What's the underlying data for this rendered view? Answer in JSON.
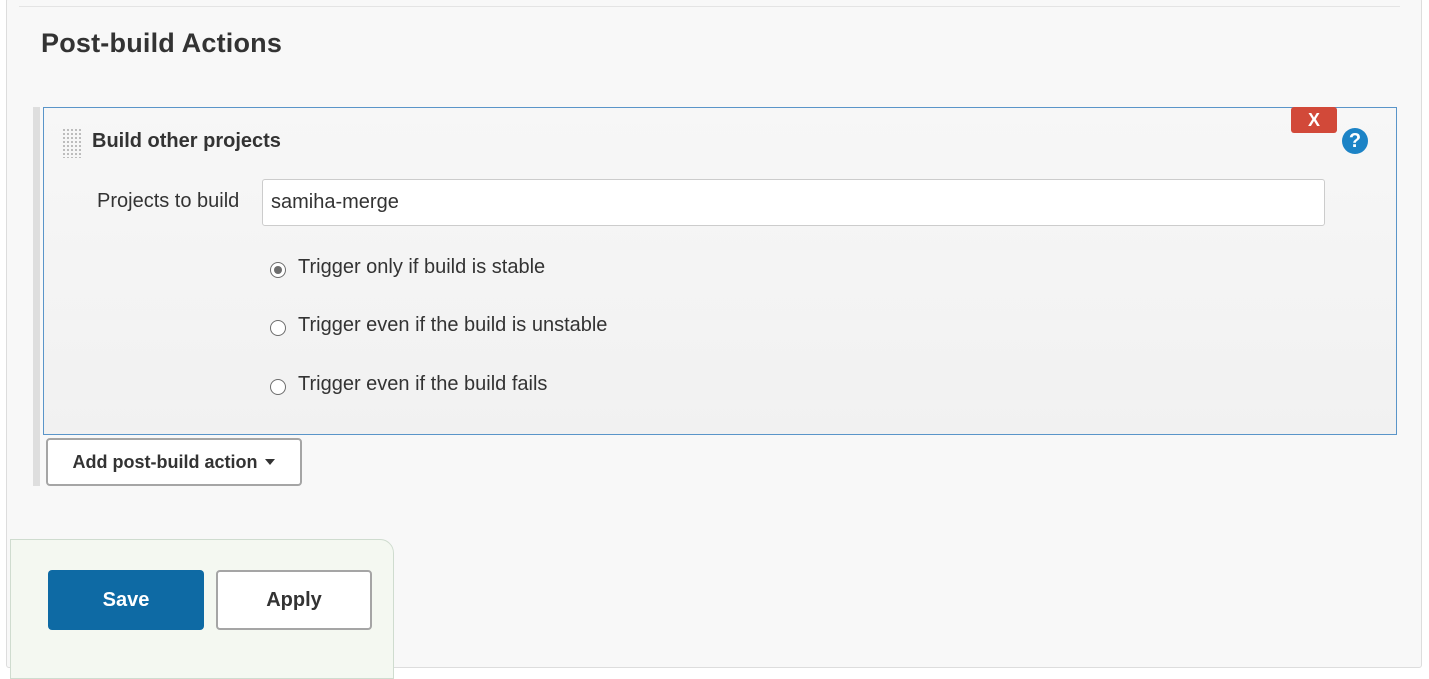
{
  "section": {
    "title": "Post-build Actions"
  },
  "action_block": {
    "title": "Build other projects",
    "delete_label": "X",
    "help_label": "?",
    "field_label": "Projects to build",
    "projects_value": "samiha-merge",
    "trigger_options": [
      {
        "label": "Trigger only if build is stable",
        "checked": true
      },
      {
        "label": "Trigger even if the build is unstable",
        "checked": false
      },
      {
        "label": "Trigger even if the build fails",
        "checked": false
      }
    ]
  },
  "add_action": {
    "label": "Add post-build action",
    "icon": "caret-down-icon"
  },
  "footer": {
    "save_label": "Save",
    "apply_label": "Apply",
    "save_color": "#0e6aa4"
  },
  "colors": {
    "delete": "#d24939",
    "help": "#1c83c6",
    "block_border": "#5a95c9"
  }
}
